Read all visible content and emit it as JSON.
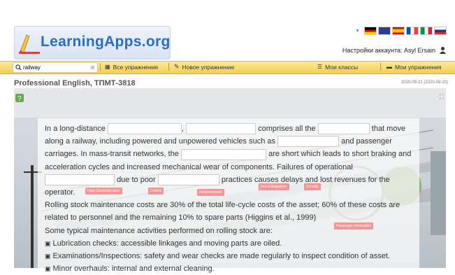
{
  "brand": "LearningApps.org",
  "account": {
    "label": "Настройки аккаунта: Asyl Ersain"
  },
  "search": {
    "value": "railway"
  },
  "toolbar": {
    "all_exercises": "Все упражнения",
    "new_exercise": "Новое упражнение",
    "my_classes": "Мои классы",
    "my_exercises": "Мои упражнения"
  },
  "page": {
    "title": "Professional English, ТПМТ-3818",
    "date": "2020-09-21 (2020-09-20)"
  },
  "text": {
    "s1a": "In a long-distance",
    "s1b": ",",
    "s1c": "comprises all the",
    "s1d": "that move along a railway, including powered and unpowered vehicles such as",
    "s1e": "and passenger carriages. In mass-transit networks, the",
    "s1f": "are short which leads to short braking and acceleration cycles and increased mechanical wear of components. Failures of operational",
    "s1g": "due to poor",
    "s1h": "practices causes delays and lost revenues for the operator.",
    "p2": "Rolling stock maintenance costs are 30% of the total life-cycle costs of the asset; 60% of these costs are related to personnel and the remaining 10% to spare parts (Higgins et al., 1999)",
    "p3": "Some typical maintenance activities performed on rolling stock are:",
    "b1": "Lubrication checks: accessible linkages and moving parts are oiled.",
    "b2": "Examinations/Inspections: safety and wear checks are made regularly to inspect condition of asset.",
    "b3": "Minor overhauls: internal and external cleaning."
  },
  "scene_labels": [
    "Data Communication",
    "Control",
    "Refurbishment",
    "Fire Extinguisher",
    "Security",
    "Passenger Information"
  ],
  "colors": {
    "toolbar": "#f6cf52",
    "brand": "#2b6cc4",
    "label_pill": "#f07878"
  }
}
